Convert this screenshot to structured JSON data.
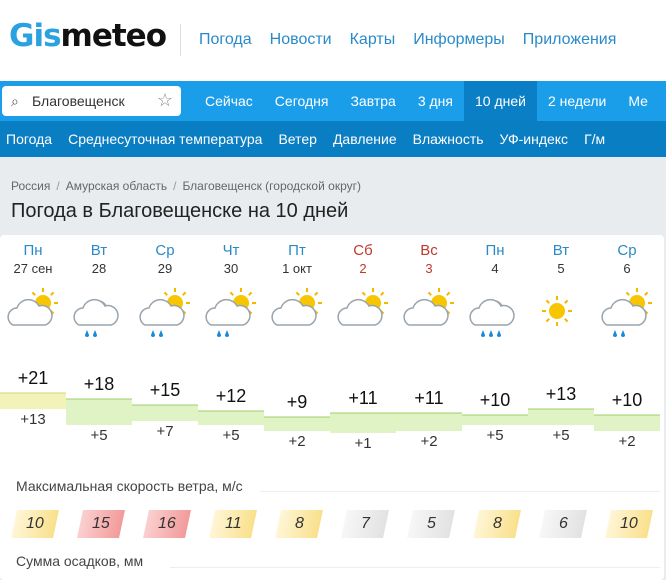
{
  "header": {
    "logo": "Gismeteo",
    "logo_a": "Gis",
    "logo_b": "meteo",
    "nav": [
      "Погода",
      "Новости",
      "Карты",
      "Информеры",
      "Приложения"
    ]
  },
  "search": {
    "value": "Благовещенск"
  },
  "tabs": {
    "items": [
      "Сейчас",
      "Сегодня",
      "Завтра",
      "3 дня",
      "10 дней",
      "2 недели",
      "Ме"
    ],
    "active": "10 дней"
  },
  "subnav": [
    "Погода",
    "Среднесуточная температура",
    "Ветер",
    "Давление",
    "Влажность",
    "УФ-индекс",
    "Г/м"
  ],
  "breadcrumb": [
    "Россия",
    "Амурская область",
    "Благовещенск (городской округ)"
  ],
  "title": "Погода в Благовещенске на 10 дней",
  "days": [
    {
      "dow": "Пн",
      "date": "27 сен",
      "weekend": false,
      "icon": "partly-cloudy",
      "max": "+21",
      "min": "+13",
      "wind": "10",
      "wind_level": "yellow"
    },
    {
      "dow": "Вт",
      "date": "28",
      "weekend": false,
      "icon": "cloud-rain",
      "max": "+18",
      "min": "+5",
      "wind": "15",
      "wind_level": "red"
    },
    {
      "dow": "Ср",
      "date": "29",
      "weekend": false,
      "icon": "partly-cloudy-rain",
      "max": "+15",
      "min": "+7",
      "wind": "16",
      "wind_level": "red"
    },
    {
      "dow": "Чт",
      "date": "30",
      "weekend": false,
      "icon": "partly-cloudy-rain",
      "max": "+12",
      "min": "+5",
      "wind": "11",
      "wind_level": "yellow"
    },
    {
      "dow": "Пт",
      "date": "1 окт",
      "weekend": false,
      "icon": "partly-cloudy",
      "max": "+9",
      "min": "+2",
      "wind": "8",
      "wind_level": "yellow"
    },
    {
      "dow": "Сб",
      "date": "2",
      "weekend": true,
      "icon": "partly-cloudy",
      "max": "+11",
      "min": "+1",
      "wind": "7",
      "wind_level": "gray"
    },
    {
      "dow": "Вс",
      "date": "3",
      "weekend": true,
      "icon": "partly-cloudy",
      "max": "+11",
      "min": "+2",
      "wind": "5",
      "wind_level": "gray"
    },
    {
      "dow": "Пн",
      "date": "4",
      "weekend": false,
      "icon": "cloud-heavy-rain",
      "max": "+10",
      "min": "+5",
      "wind": "8",
      "wind_level": "yellow"
    },
    {
      "dow": "Вт",
      "date": "5",
      "weekend": false,
      "icon": "sun",
      "max": "+13",
      "min": "+5",
      "wind": "6",
      "wind_level": "gray"
    },
    {
      "dow": "Ср",
      "date": "6",
      "weekend": false,
      "icon": "partly-cloudy-rain",
      "max": "+10",
      "min": "+2",
      "wind": "10",
      "wind_level": "yellow"
    }
  ],
  "wind_label": "Максимальная скорость ветра, м/с",
  "precip_label": "Сумма осадков, мм",
  "colors": {
    "brand": "#2aa1e0",
    "nav": "#1b9eea",
    "subnav": "#0a7ec3",
    "yellow": "#fbe49a",
    "red": "#f4a0a0",
    "gray": "#e8e8e8",
    "band": "#dff3c4",
    "band_warm": "#f2f3b8"
  }
}
